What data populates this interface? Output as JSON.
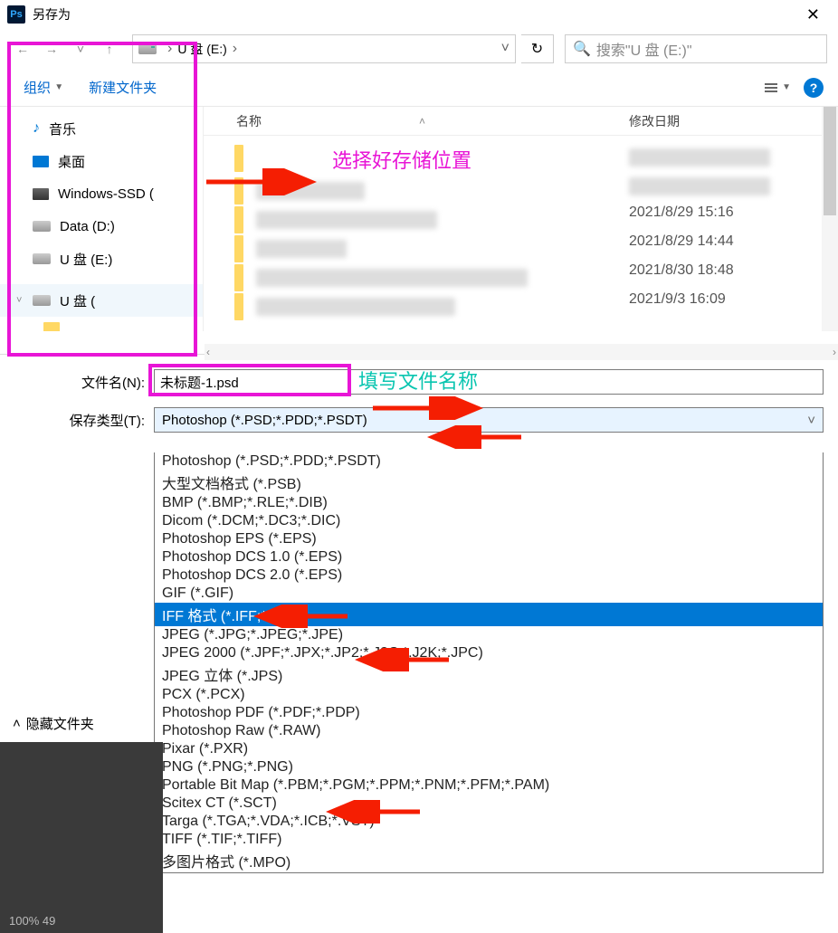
{
  "window": {
    "title": "另存为",
    "ps_badge": "Ps"
  },
  "nav": {
    "drive_label": "U 盘 (E:)",
    "search_placeholder": "搜索\"U 盘 (E:)\""
  },
  "toolbar": {
    "organize": "组织",
    "new_folder": "新建文件夹"
  },
  "tree": {
    "items": [
      "音乐",
      "桌面",
      "Windows-SSD (",
      "Data (D:)",
      "U 盘 (E:)",
      "U 盘 ("
    ]
  },
  "filelist": {
    "col_name": "名称",
    "col_date": "修改日期",
    "dates": [
      "2021/8/29 15:16",
      "2021/8/29 14:44",
      "2021/8/30 18:48",
      "2021/9/3 16:09"
    ]
  },
  "annotations": {
    "choose_location": "选择好存储位置",
    "fill_filename": "填写文件名称"
  },
  "filename": {
    "label": "文件名(N):",
    "value": "未标题-1.psd",
    "type_label": "保存类型(T):",
    "current_type": "Photoshop (*.PSD;*.PDD;*.PSDT)"
  },
  "file_types": [
    "Photoshop (*.PSD;*.PDD;*.PSDT)",
    "大型文档格式 (*.PSB)",
    "BMP (*.BMP;*.RLE;*.DIB)",
    "Dicom (*.DCM;*.DC3;*.DIC)",
    "Photoshop EPS (*.EPS)",
    "Photoshop DCS 1.0 (*.EPS)",
    "Photoshop DCS 2.0 (*.EPS)",
    "GIF (*.GIF)",
    "IFF 格式 (*.IFF;*.TDI)",
    "JPEG (*.JPG;*.JPEG;*.JPE)",
    "JPEG 2000 (*.JPF;*.JPX;*.JP2;*.J2C;*.J2K;*.JPC)",
    "JPEG 立体 (*.JPS)",
    "PCX (*.PCX)",
    "Photoshop PDF (*.PDF;*.PDP)",
    "Photoshop Raw (*.RAW)",
    "Pixar (*.PXR)",
    "PNG (*.PNG;*.PNG)",
    "Portable Bit Map (*.PBM;*.PGM;*.PPM;*.PNM;*.PFM;*.PAM)",
    "Scitex CT (*.SCT)",
    "Targa (*.TGA;*.VDA;*.ICB;*.VST)",
    "TIFF (*.TIF;*.TIFF)",
    "多图片格式 (*.MPO)"
  ],
  "highlighted_type_index": 8,
  "bottom": {
    "hide_folders": "隐藏文件夹",
    "zoom": "100%   49"
  }
}
